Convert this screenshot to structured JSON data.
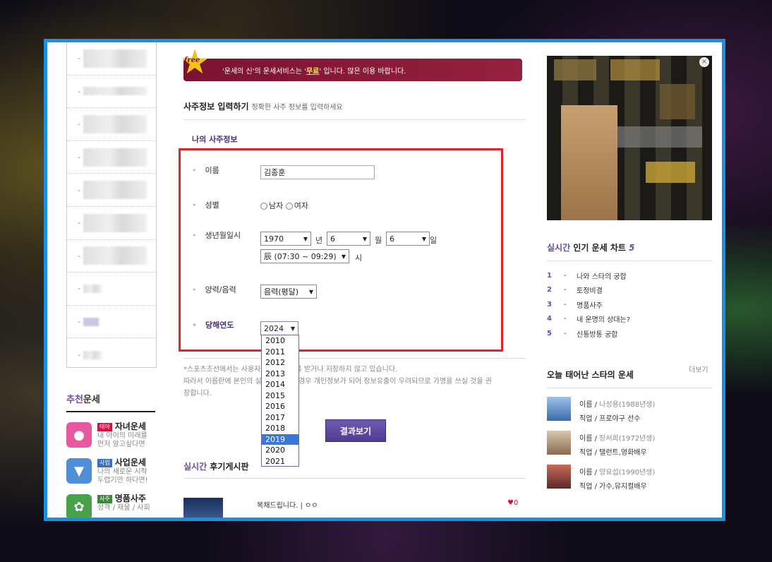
{
  "notice": {
    "free_badge": "free",
    "text_before": "'운세의 신'의 운세서비스는 '",
    "free_word": "무료",
    "text_after": "' 입니다. 많은 이용 바랍니다."
  },
  "form": {
    "section_title": "사주정보 입력하기",
    "section_sub": "정확한 사주 정보를 입력하세요",
    "my_info_label": "나의 사주정보",
    "name_label": "이름",
    "name_value": "김종훈",
    "gender_label": "성별",
    "gender_male": "남자",
    "gender_female": "여자",
    "birth_label": "생년월일시",
    "year_value": "1970",
    "year_unit": "년",
    "month_value": "6",
    "month_unit": "월",
    "day_value": "6",
    "day_unit": "일",
    "hour_value": "辰 (07:30 ~ 09:29)",
    "hour_unit": "시",
    "calendar_label": "양력/음력",
    "calendar_value": "음력(평달)",
    "target_year_label": "당해연도",
    "target_year_value": "2024",
    "target_year_options": [
      "2010",
      "2011",
      "2012",
      "2013",
      "2014",
      "2015",
      "2016",
      "2017",
      "2018",
      "2019",
      "2020",
      "2021"
    ],
    "target_year_highlighted": "2019"
  },
  "disclaimer": {
    "line1": "*스포츠조선에서는 사용자의 개인정보를 받거나 저장하지 않고 있습니다.",
    "line2": "따라서 이름란에 본인의 실명을 입력할 경우 개인정보가 되어 정보유출이 우려되므로 가명을 쓰실 것을 권",
    "line3": "장합니다."
  },
  "result_button": "결과보기",
  "review": {
    "title_accent": "실시간",
    "title_rest": " 후기게시판",
    "item_text": "복채드립니다. |  ㅇㅇ",
    "likes": "♥0"
  },
  "recommend": {
    "title_accent": "추천",
    "title_rest": "운세",
    "items": [
      {
        "tag": "태아",
        "title": "자녀운세",
        "desc1": "내 아이의 미래를",
        "desc2": "먼저 알고싶다면"
      },
      {
        "tag": "사업",
        "title": "사업운세",
        "desc1": "나의 새로운 시작",
        "desc2": "두렵기만 하다면!"
      },
      {
        "tag": "사주",
        "title": "명품사주",
        "desc1": "성격 / 재물 / 사회",
        "desc2": ""
      }
    ]
  },
  "ad": {
    "close": "×"
  },
  "chart": {
    "title_accent": "실시간",
    "title_rest": " 인기 운세 차트 ",
    "title_num": "5",
    "items": [
      {
        "rank": "1",
        "label": "나와 스타의 궁합"
      },
      {
        "rank": "2",
        "label": "토정비결"
      },
      {
        "rank": "3",
        "label": "명품사주"
      },
      {
        "rank": "4",
        "label": "내 운명의 상대는?"
      },
      {
        "rank": "5",
        "label": "신통방통 궁합"
      }
    ]
  },
  "stars": {
    "title": "오늘 태어난 스타의 운세",
    "more": "더보기",
    "items": [
      {
        "name_prefix": "이름 / ",
        "name": "나성용(1988년생)",
        "job": "직업 / 프로야구 선수"
      },
      {
        "name_prefix": "이름 / ",
        "name": "장서희(1972년생)",
        "job": "직업 / 탤런트,영화배우"
      },
      {
        "name_prefix": "이름 / ",
        "name": "양요섭(1990년생)",
        "job": "직업 / 가수,뮤지컬배우"
      }
    ]
  }
}
